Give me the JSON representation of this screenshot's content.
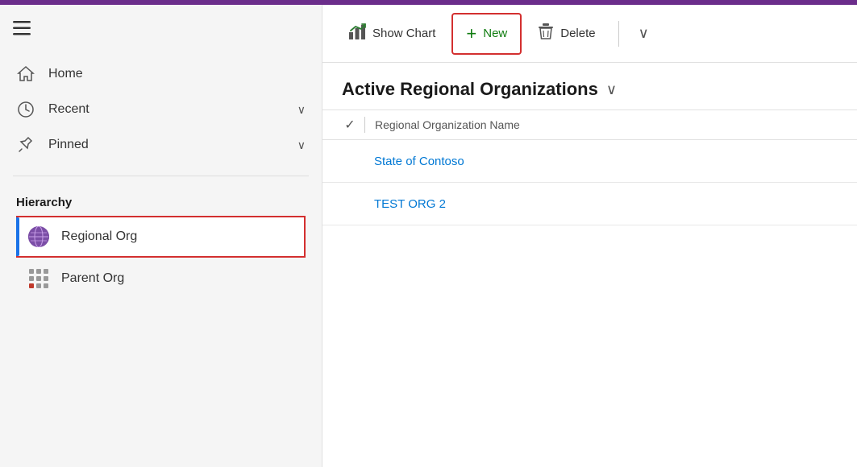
{
  "topbar": {
    "color": "#6b2d8b"
  },
  "sidebar": {
    "hamburger_label": "☰",
    "nav_items": [
      {
        "label": "Home",
        "icon": "home-icon"
      },
      {
        "label": "Recent",
        "icon": "recent-icon",
        "chevron": "∨"
      },
      {
        "label": "Pinned",
        "icon": "pin-icon",
        "chevron": "∨"
      }
    ],
    "hierarchy_title": "Hierarchy",
    "hierarchy_items": [
      {
        "label": "Regional Org",
        "icon": "globe-icon",
        "active": true
      },
      {
        "label": "Parent Org",
        "icon": "grid-icon",
        "active": false
      }
    ]
  },
  "toolbar": {
    "show_chart_label": "Show Chart",
    "new_label": "New",
    "delete_label": "Delete",
    "more_icon": "∨"
  },
  "main": {
    "view_title": "Active Regional Organizations",
    "column_header": "Regional Organization Name",
    "rows": [
      {
        "label": "State of Contoso"
      },
      {
        "label": "TEST ORG 2"
      }
    ]
  }
}
